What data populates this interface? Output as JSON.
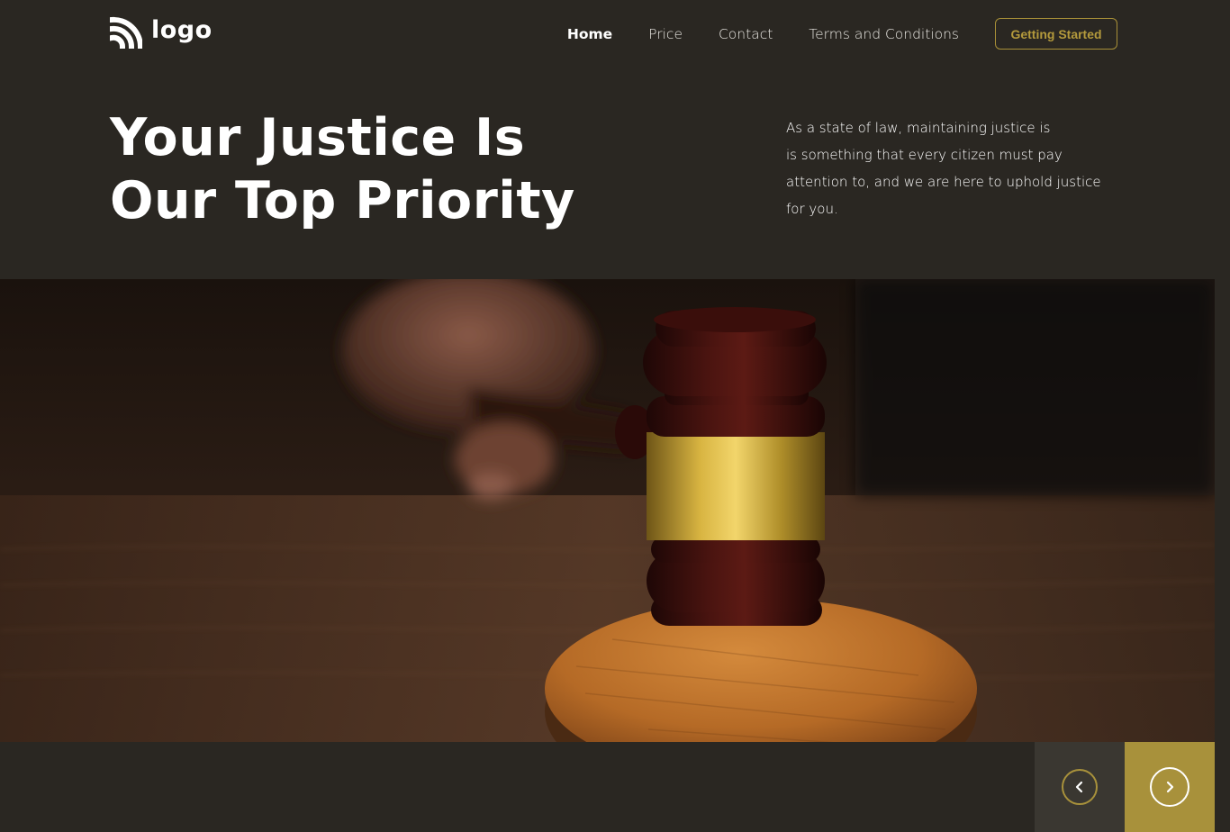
{
  "brand": {
    "logo_text": "logo",
    "logo_icon": "signal-arcs-icon"
  },
  "nav": {
    "items": [
      {
        "label": "Home",
        "active": true
      },
      {
        "label": "Price",
        "active": false
      },
      {
        "label": "Contact",
        "active": false
      },
      {
        "label": "Terms and Conditions",
        "active": false
      }
    ],
    "cta_label": "Getting Started"
  },
  "hero": {
    "title_lines": [
      "Your Justice Is",
      "Our Top Priority"
    ],
    "description_lines": [
      "As a state of law, maintaining justice is",
      "is something that every citizen must pay",
      "attention to, and we are here to uphold justice",
      "for you."
    ],
    "image_subject": "judge-gavel-on-sound-block"
  },
  "slider": {
    "prev_icon": "chevron-left-icon",
    "next_icon": "chevron-right-icon"
  },
  "colors": {
    "background": "#2a2722",
    "accent": "#a8913b",
    "prev_button_bg": "#3a3731",
    "text": "#ffffff"
  }
}
